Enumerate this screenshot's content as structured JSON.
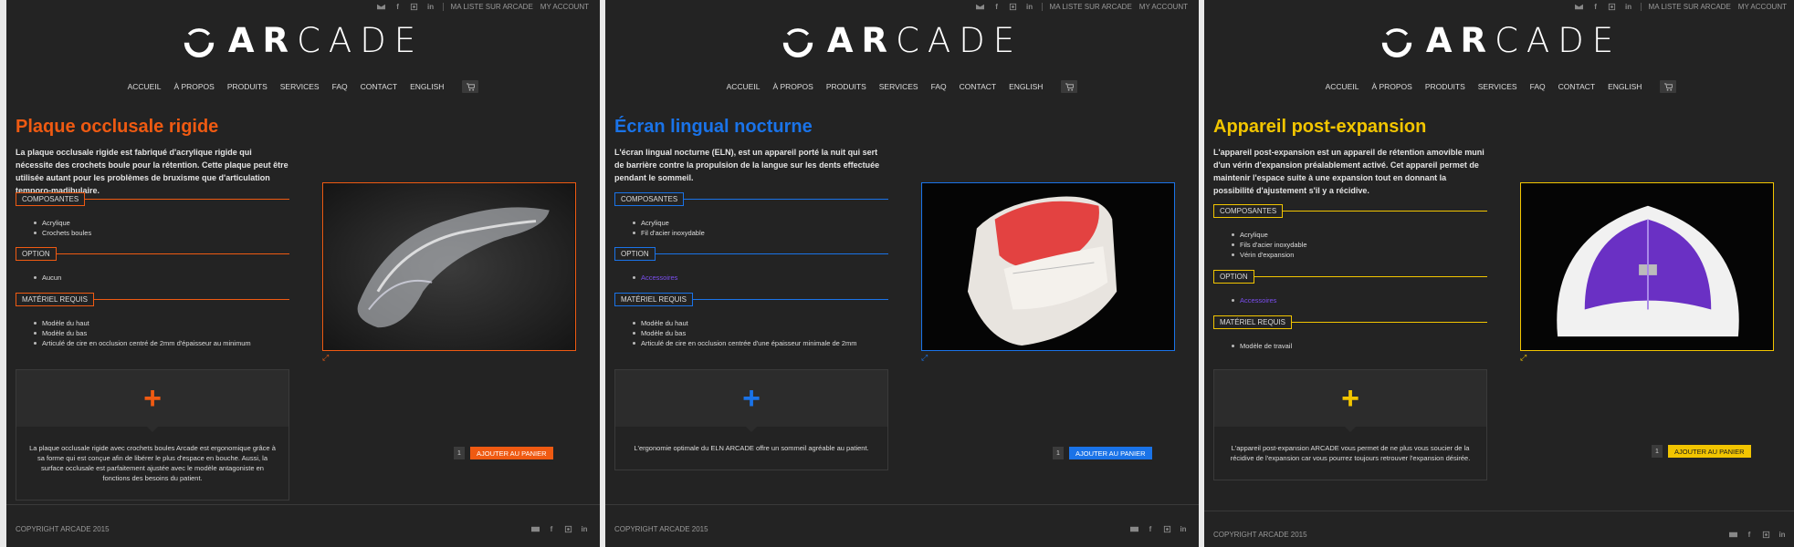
{
  "topbar": {
    "icons": [
      "envelope-icon",
      "facebook-icon",
      "instagram-icon",
      "linkedin-icon"
    ],
    "wishlist": "MA LISTE SUR ARCADE",
    "account": "MY ACCOUNT"
  },
  "logo": {
    "text": "ARCADE"
  },
  "nav": [
    "ACCUEIL",
    "À PROPOS",
    "PRODUITS",
    "SERVICES",
    "FAQ",
    "CONTACT",
    "ENGLISH"
  ],
  "footer": {
    "copyright": "COPYRIGHT ARCADE 2015"
  },
  "panels": [
    {
      "accent": "#ef5a12",
      "title": "Plaque occlusale rigide",
      "description": "La plaque occlusale rigide est fabriqué d'acrylique rigide qui nécessite des crochets boule pour la rétention. Cette plaque peut être utilisée autant pour les problèmes de bruxisme que d'articulation temporo-madibulaire.",
      "sections": [
        {
          "label": "COMPOSANTES",
          "items": [
            "Acrylique",
            "Crochets boules"
          ]
        },
        {
          "label": "OPTION",
          "items": [
            "Aucun"
          ]
        },
        {
          "label": "MATÉRIEL REQUIS",
          "items": [
            "Modèle du haut",
            "Modèle du bas",
            "Articulé de cire en occlusion centré de 2mm d'épaisseur au minimum"
          ]
        }
      ],
      "image": "clear-occlusal-splint",
      "plus_text": "La plaque occlusale rigide avec crochets boules Arcade est ergonomique grâce à sa forme qui est conçue afin de libérer le plus d'espace en bouche. Aussi, la surface occlusale est parfaitement ajustée avec le modèle antagoniste en fonctions des besoins du patient.",
      "qty": "1",
      "add_label": "AJOUTER AU PANIER"
    },
    {
      "accent": "#1a73e8",
      "title": "Écran lingual nocturne",
      "description": "L'écran lingual nocturne (ELN), est un appareil porté la nuit qui sert de barrière contre la propulsion de la langue sur les dents effectuée pendant le sommeil.",
      "sections": [
        {
          "label": "COMPOSANTES",
          "items": [
            "Acrylique",
            "Fil d'acier inoxydable"
          ]
        },
        {
          "label": "OPTION",
          "items": [
            "Accessoires"
          ],
          "link": true
        },
        {
          "label": "MATÉRIEL REQUIS",
          "items": [
            "Modèle du haut",
            "Modèle du bas",
            "Articulé de cire en occlusion centrée d'une épaisseur minimale de 2mm"
          ]
        }
      ],
      "image": "red-lingual-screen",
      "plus_text": "L'ergonomie optimale du ELN ARCADE offre un sommeil agréable au patient.",
      "qty": "1",
      "add_label": "AJOUTER AU PANIER"
    },
    {
      "accent": "#f2c500",
      "title": "Appareil post-expansion",
      "description": "L'appareil post-expansion est un appareil de rétention amovible muni d'un vérin d'expansion préalablement activé. Cet appareil permet de maintenir l'espace suite à une expansion tout en donnant la possibilité d'ajustement s'il y a récidive.",
      "sections": [
        {
          "label": "COMPOSANTES",
          "items": [
            "Acrylique",
            "Fils d'acier inoxydable",
            "Vérin d'expansion"
          ]
        },
        {
          "label": "OPTION",
          "items": [
            "Accessoires"
          ],
          "link": true
        },
        {
          "label": "MATÉRIEL REQUIS",
          "items": [
            "Modèle de travail"
          ]
        }
      ],
      "image": "purple-expansion-appliance",
      "plus_text": "L'appareil post-expansion ARCADE vous permet de ne plus vous soucier de la récidive de l'expansion car vous pourrez toujours retrouver l'expansion désirée.",
      "qty": "1",
      "add_label": "AJOUTER AU PANIER"
    }
  ]
}
